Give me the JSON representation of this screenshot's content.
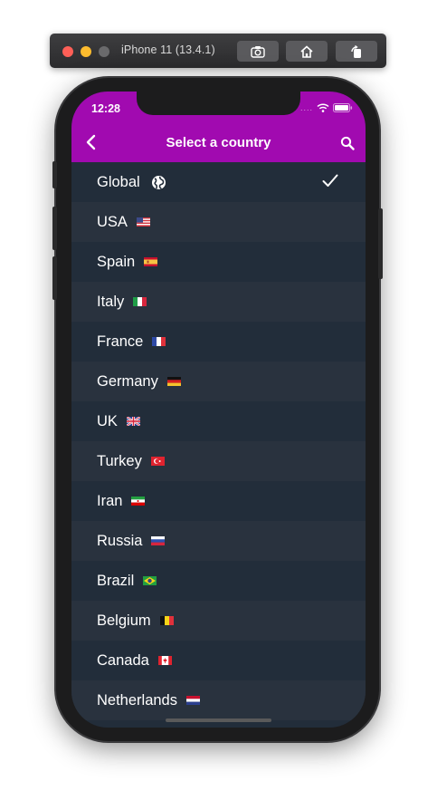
{
  "simulator": {
    "title": "iPhone 11 (13.4.1)",
    "buttons": [
      "camera-icon",
      "home-icon",
      "rotate-icon"
    ]
  },
  "status_bar": {
    "time": "12:28",
    "signal": "....",
    "icons": [
      "wifi-icon",
      "battery-icon"
    ]
  },
  "nav": {
    "title": "Select a country",
    "back_icon": "chevron-left-icon",
    "search_icon": "search-icon"
  },
  "countries": [
    {
      "name": "Global",
      "icon": "globe-icon",
      "selected": true
    },
    {
      "name": "USA",
      "icon": "flag-usa"
    },
    {
      "name": "Spain",
      "icon": "flag-spain"
    },
    {
      "name": "Italy",
      "icon": "flag-italy"
    },
    {
      "name": "France",
      "icon": "flag-france"
    },
    {
      "name": "Germany",
      "icon": "flag-germany"
    },
    {
      "name": "UK",
      "icon": "flag-uk"
    },
    {
      "name": "Turkey",
      "icon": "flag-turkey"
    },
    {
      "name": "Iran",
      "icon": "flag-iran"
    },
    {
      "name": "Russia",
      "icon": "flag-russia"
    },
    {
      "name": "Brazil",
      "icon": "flag-brazil"
    },
    {
      "name": "Belgium",
      "icon": "flag-belgium"
    },
    {
      "name": "Canada",
      "icon": "flag-canada"
    },
    {
      "name": "Netherlands",
      "icon": "flag-netherlands"
    }
  ],
  "colors": {
    "header": "#a10ab0",
    "row_odd": "#222d3a",
    "row_even": "#29323e",
    "text": "#ffffff"
  }
}
